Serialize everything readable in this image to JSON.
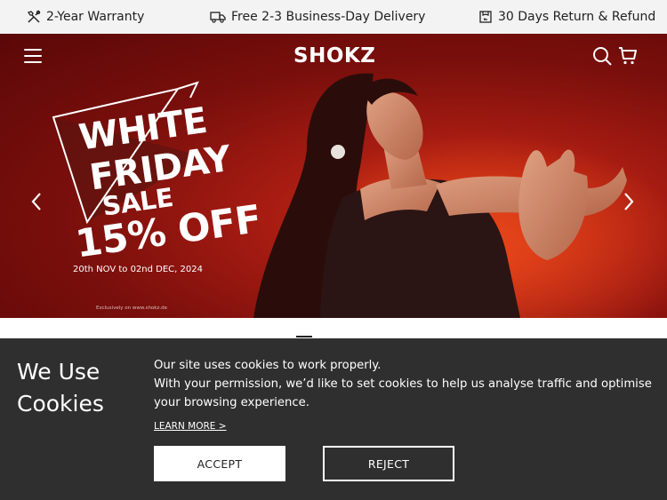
{
  "topbar": {
    "warranty": "2-Year Warranty",
    "delivery": "Free 2-3 Business-Day Delivery",
    "returns": "30 Days Return & Refund"
  },
  "header": {
    "logo": "SHOKZ",
    "icons": [
      "menu-icon",
      "search-icon",
      "cart-icon"
    ]
  },
  "hero": {
    "promo_line1": "WHITE",
    "promo_line2": "FRIDAY",
    "promo_line3": "SALE",
    "promo_line4": "15% OFF",
    "dates": "20th NOV to 02nd DEC, 2024",
    "fine_print": "Exclusively on www.shokz.de",
    "accent_color": "#a71c12"
  },
  "cookie_banner": {
    "title": "We Use Cookies",
    "body_line1": "Our site uses cookies to work properly.",
    "body_line2": "With your permission, we’d like to set cookies to help us analyse traffic and optimise your browsing experience.",
    "learn_more": "LEARN MORE >",
    "accept": "ACCEPT",
    "reject": "REJECT",
    "background": "#2f2f2f"
  }
}
